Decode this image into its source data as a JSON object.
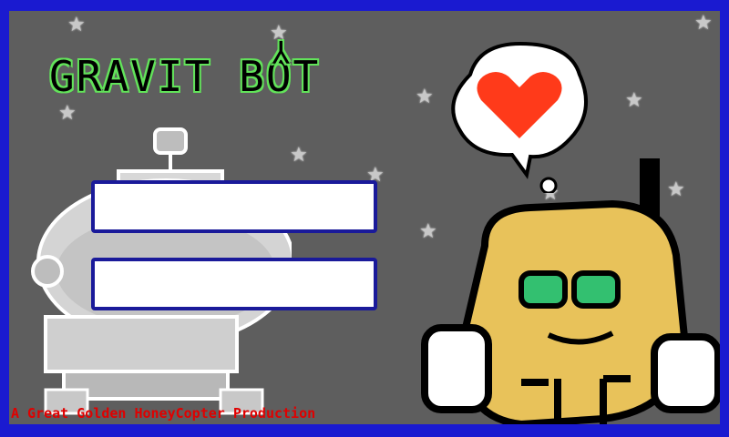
{
  "title": {
    "text_left": "GRAVIT",
    "text_mid": "Y",
    "text_right": "BOT"
  },
  "login": {
    "username_value": "",
    "password_value": ""
  },
  "credit": "A Great Golden HoneyCopter Production",
  "colors": {
    "frame": "#1a1ad0",
    "background": "#5e5e5e",
    "title_outline": "#62e35a",
    "credit_text": "#e00000",
    "field_border": "#1a1a9a",
    "heart": "#ff3a1a",
    "robot_body": "#e8c25a"
  },
  "icons": [
    "star-icon",
    "heart-icon",
    "satellite-icon",
    "robot-icon"
  ]
}
